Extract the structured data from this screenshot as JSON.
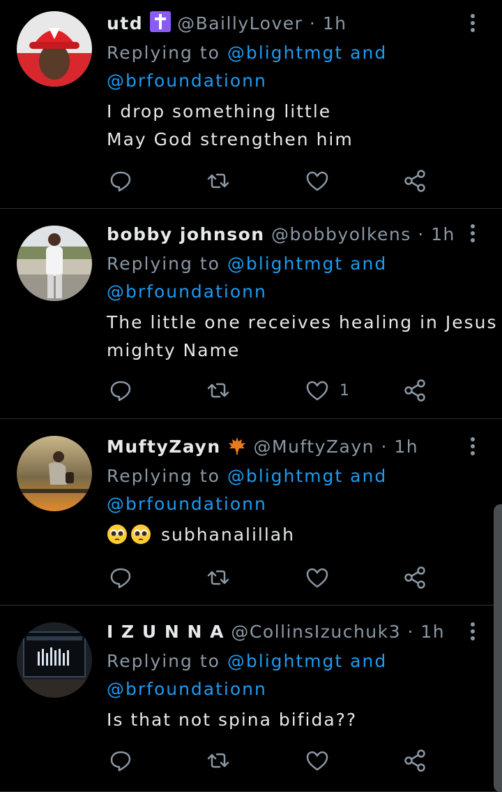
{
  "tweets": [
    {
      "name": "utd",
      "handle": "@BaillyLover",
      "dot": "·",
      "time": "1h",
      "replying_prefix": "Replying to",
      "mention1": "@blightmgt",
      "and_word": "and",
      "mention2": "@brfoundationn",
      "text_lines": [
        "I drop something little",
        "May God strengthen him"
      ],
      "like_count": ""
    },
    {
      "name": "bobby johnson",
      "handle": "@bobbyolkens",
      "dot": "·",
      "time": "1h",
      "replying_prefix": "Replying to",
      "mention1": "@blightmgt",
      "and_word": "and",
      "mention2": "@brfoundationn",
      "text_lines": [
        "The little one receives healing in Jesus",
        "mighty Name"
      ],
      "like_count": "1"
    },
    {
      "name": "MuftyZayn",
      "handle": "@MuftyZayn",
      "dot": "·",
      "time": "1h",
      "replying_prefix": "Replying to",
      "mention1": "@blightmgt",
      "and_word": "and",
      "mention2": "@brfoundationn",
      "text_lines": [
        "subhanalillah"
      ],
      "like_count": ""
    },
    {
      "name": "I Z U N N A",
      "handle": "@CollinsIzuchuk3",
      "dot": "·",
      "time": "1h",
      "replying_prefix": "Replying to",
      "mention1": "@blightmgt",
      "and_word": "and",
      "mention2": "@brfoundationn",
      "text_lines": [
        "Is that not spina bifida??"
      ],
      "like_count": ""
    }
  ],
  "colors": {
    "background": "#000000",
    "text": "#e7e9ea",
    "secondary": "#8b98a5",
    "link": "#1d9bf0",
    "divider": "#2f3336",
    "cross_badge": "#8a5cf5"
  },
  "icons": {
    "reply": "reply-icon",
    "retweet": "retweet-icon",
    "like": "heart-icon",
    "share": "share-icon",
    "more": "more-vertical-icon"
  }
}
